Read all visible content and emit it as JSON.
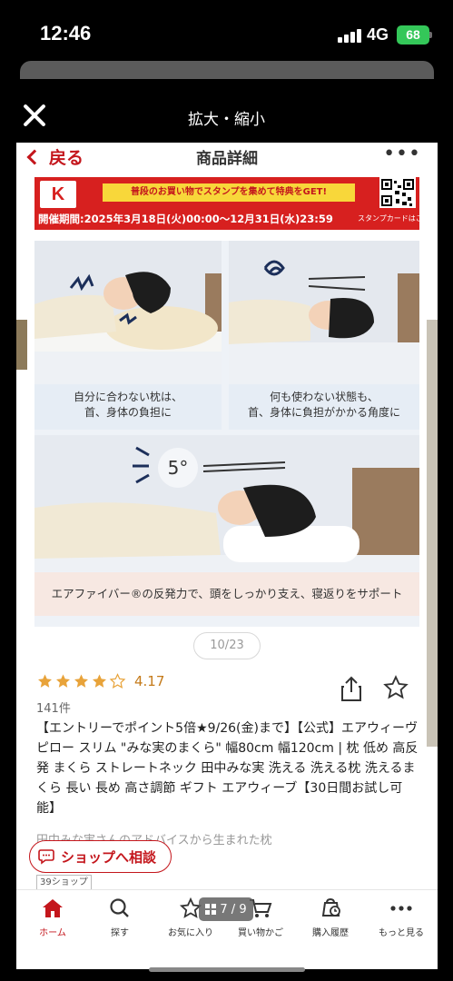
{
  "status_bar": {
    "time": "12:46",
    "network": "4G",
    "battery": "68"
  },
  "viewer": {
    "title": "拡大・縮小",
    "counter": "7 / 9"
  },
  "app_header": {
    "back_label": "戻る",
    "title": "商品詳細",
    "more": "•••"
  },
  "promo_banner": {
    "logo": "K",
    "headline": "普段のお買い物でスタンプを集めて特典をGET!",
    "period": "開催期間:2025年3月18日(火)00:00〜12月31日(水)23:59",
    "card_link": "スタンプカードはこちら"
  },
  "product_image": {
    "caption_left": [
      "自分に合わない枕は、",
      "首、身体の負担に"
    ],
    "caption_right": [
      "何も使わない状態も、",
      "首、身体に負担がかかる角度に"
    ],
    "angle_label": "5°",
    "bottom_caption": "エアファイバー®の反発力で、頭をしっかり支え、寝返りをサポート"
  },
  "image_pager": {
    "label": "10/23"
  },
  "rating": {
    "value": "4.17",
    "stars": 4,
    "count": "141件"
  },
  "product": {
    "title": "【エントリーでポイント5倍★9/26(金)まで】【公式】エアウィーヴ ピロー スリム \"みな実のまくら\" 幅80cm 幅120cm | 枕 低め 高反発 まくら ストレートネック 田中みな実 洗える 洗える枕 洗えるまくら 長い 長め 高さ調節 ギフト エアウィーブ【30日間お試し可能】",
    "subtitle": "田中みな実さんのアドバイスから生まれた枕"
  },
  "shop": {
    "chat_label": "ショップへ相談",
    "tag": "39ショップ"
  },
  "tab_bar": [
    {
      "label": "ホーム",
      "icon": "home-icon",
      "active": true
    },
    {
      "label": "探す",
      "icon": "search-icon",
      "active": false
    },
    {
      "label": "お気に入り",
      "icon": "star-icon",
      "active": false
    },
    {
      "label": "買い物かご",
      "icon": "cart-icon",
      "active": false
    },
    {
      "label": "購入履歴",
      "icon": "history-icon",
      "active": false
    },
    {
      "label": "もっと見る",
      "icon": "more-icon",
      "active": false
    }
  ],
  "colors": {
    "brand_red": "#c4161c",
    "star": "#e8a33a",
    "rating_text": "#c47a19",
    "battery": "#34c759"
  }
}
